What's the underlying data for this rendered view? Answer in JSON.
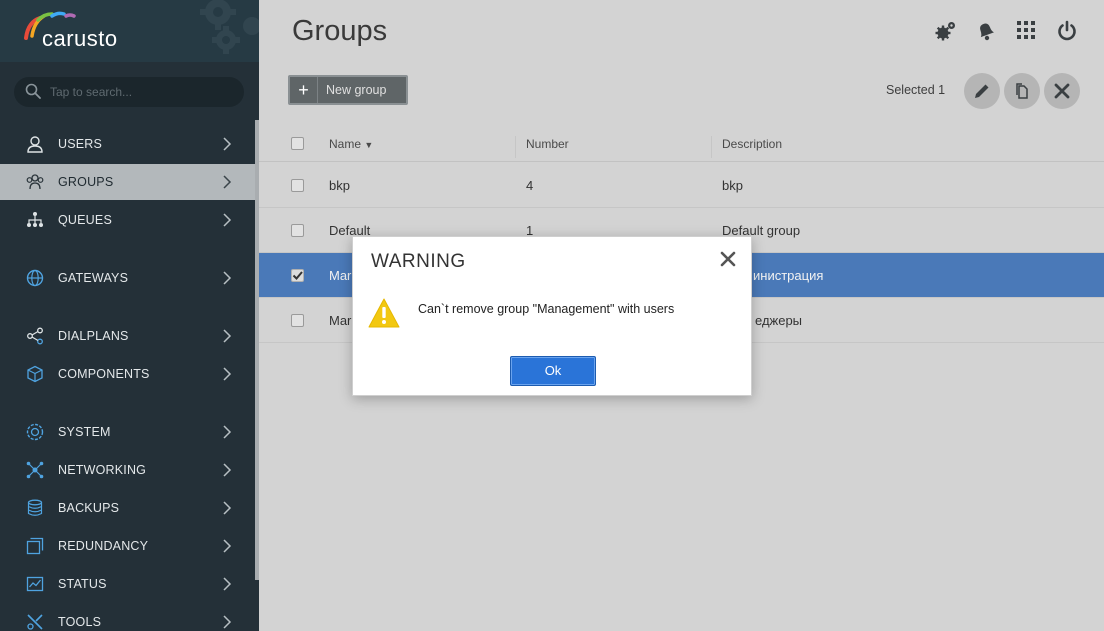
{
  "app": {
    "logo_text": "carusto"
  },
  "search": {
    "placeholder": "Tap to search..."
  },
  "sidebar": {
    "items": [
      {
        "label": "USERS",
        "icon": "user-icon",
        "active": false
      },
      {
        "label": "GROUPS",
        "icon": "group-icon",
        "active": true
      },
      {
        "label": "QUEUES",
        "icon": "queues-icon",
        "active": false
      },
      {
        "label": "GATEWAYS",
        "icon": "globe-icon",
        "active": false
      },
      {
        "label": "DIALPLANS",
        "icon": "share-icon",
        "active": false
      },
      {
        "label": "COMPONENTS",
        "icon": "cube-icon",
        "active": false
      },
      {
        "label": "SYSTEM",
        "icon": "system-icon",
        "active": false
      },
      {
        "label": "NETWORKING",
        "icon": "network-icon",
        "active": false
      },
      {
        "label": "BACKUPS",
        "icon": "database-icon",
        "active": false
      },
      {
        "label": "REDUNDANCY",
        "icon": "redundancy-icon",
        "active": false
      },
      {
        "label": "STATUS",
        "icon": "chart-icon",
        "active": false
      },
      {
        "label": "TOOLS",
        "icon": "tools-icon",
        "active": false
      }
    ]
  },
  "header": {
    "title": "Groups",
    "icons": [
      "settings-icon",
      "bell-icon",
      "apps-grid-icon",
      "power-icon"
    ]
  },
  "toolbar": {
    "new_group_label": "New group",
    "selected_text": "Selected 1",
    "actions": [
      "edit-icon",
      "copy-icon",
      "delete-icon"
    ]
  },
  "table": {
    "columns": [
      "Name",
      "Number",
      "Description"
    ],
    "rows": [
      {
        "name": "bkp",
        "number": "4",
        "description": "bkp",
        "selected": false
      },
      {
        "name": "Default",
        "number": "1",
        "description": "Default group",
        "selected": false
      },
      {
        "name": "Mar",
        "number": "",
        "description": "инистрация",
        "selected": true
      },
      {
        "name": "Mar",
        "number": "",
        "description": "еджеры",
        "selected": false
      }
    ]
  },
  "modal": {
    "title": "WARNING",
    "message": "Can`t remove group \"Management\" with users",
    "ok_label": "Ok"
  },
  "colors": {
    "sidebar_bg": "#243038",
    "selected_row": "#4a79b8",
    "ok_button": "#2a74d8",
    "warning_icon": "#f2c811"
  }
}
